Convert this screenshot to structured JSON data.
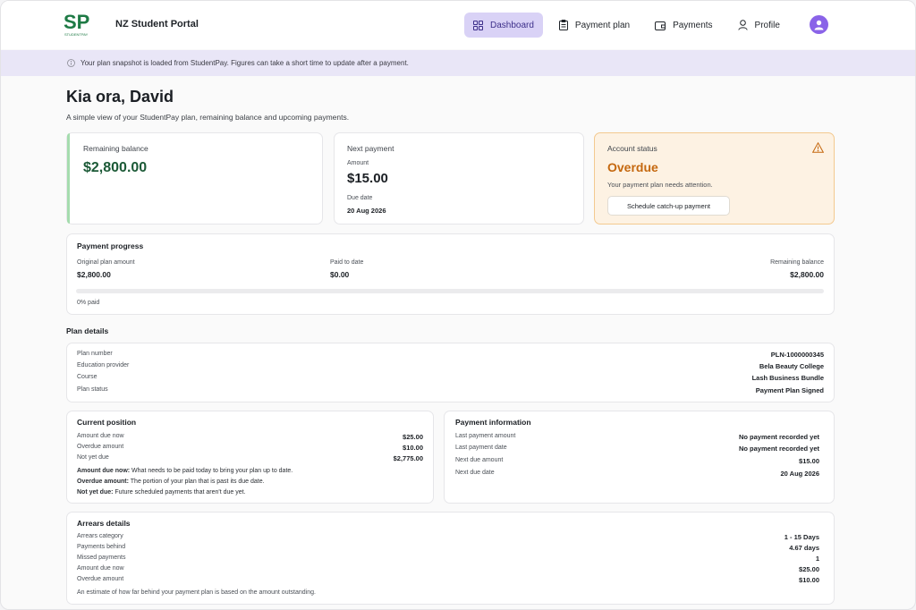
{
  "header": {
    "portal_title": "NZ Student Portal",
    "logo_letters": "SP",
    "logo_tagline": "STUDENTPAY",
    "nav": [
      {
        "label": "Dashboard",
        "icon": "grid-icon",
        "active": true
      },
      {
        "label": "Payment plan",
        "icon": "clipboard-icon",
        "active": false
      },
      {
        "label": "Payments",
        "icon": "wallet-icon",
        "active": false
      },
      {
        "label": "Profile",
        "icon": "user-icon",
        "active": false
      }
    ]
  },
  "banner": {
    "text": "Your plan snapshot is loaded from StudentPay. Figures can take a short time to update after a payment."
  },
  "greeting": {
    "title": "Kia ora, David",
    "subtitle": "A simple view of your StudentPay plan, remaining balance and upcoming payments."
  },
  "remaining_balance": {
    "label": "Remaining balance",
    "value": "$2,800.00"
  },
  "next_payment": {
    "label": "Next payment",
    "amount_label": "Amount",
    "amount": "$15.00",
    "due_label": "Due date",
    "due_date": "20 Aug 2026"
  },
  "account_status": {
    "label": "Account status",
    "status": "Overdue",
    "message": "Your payment plan needs attention.",
    "button": "Schedule catch-up payment"
  },
  "progress": {
    "title": "Payment progress",
    "original_label": "Original plan amount",
    "original_value": "$2,800.00",
    "paid_label": "Paid to date",
    "paid_value": "$0.00",
    "remaining_label": "Remaining balance",
    "remaining_value": "$2,800.00",
    "percent_text": "0% paid",
    "percent": 0
  },
  "plan_details": {
    "title": "Plan details",
    "rows": [
      {
        "label": "Plan number",
        "value": "PLN-1000000345"
      },
      {
        "label": "Education provider",
        "value": "Bela Beauty College"
      },
      {
        "label": "Course",
        "value": "Lash Business Bundle"
      },
      {
        "label": "Plan status",
        "value": "Payment Plan Signed"
      }
    ]
  },
  "current_position": {
    "title": "Current position",
    "rows": [
      {
        "label": "Amount due now",
        "value": "$25.00"
      },
      {
        "label": "Overdue amount",
        "value": "$10.00"
      },
      {
        "label": "Not yet due",
        "value": "$2,775.00"
      }
    ],
    "notes": [
      {
        "term": "Amount due now:",
        "text": " What needs to be paid today to bring your plan up to date."
      },
      {
        "term": "Overdue amount:",
        "text": " The portion of your plan that is past its due date."
      },
      {
        "term": "Not yet due:",
        "text": " Future scheduled payments that aren't due yet."
      }
    ]
  },
  "payment_information": {
    "title": "Payment information",
    "rows": [
      {
        "label": "Last payment amount",
        "value": "No payment recorded yet"
      },
      {
        "label": "Last payment date",
        "value": "No payment recorded yet"
      },
      {
        "label": "Next due amount",
        "value": "$15.00"
      },
      {
        "label": "Next due date",
        "value": "20 Aug 2026"
      }
    ]
  },
  "arrears": {
    "title": "Arrears details",
    "rows": [
      {
        "label": "Arrears category",
        "value": "1 - 15 Days"
      },
      {
        "label": "Payments behind",
        "value": "4.67 days"
      },
      {
        "label": "Missed payments",
        "value": "1"
      },
      {
        "label": "Amount due now",
        "value": "$25.00"
      },
      {
        "label": "Overdue amount",
        "value": "$10.00"
      }
    ],
    "footnote": "An estimate of how far behind your payment plan is based on the amount outstanding."
  },
  "colors": {
    "accent": "#d9d2f6",
    "brand_green": "#1e6b3c",
    "overdue": "#c5680f",
    "warning_bg": "#fdf2e3"
  }
}
